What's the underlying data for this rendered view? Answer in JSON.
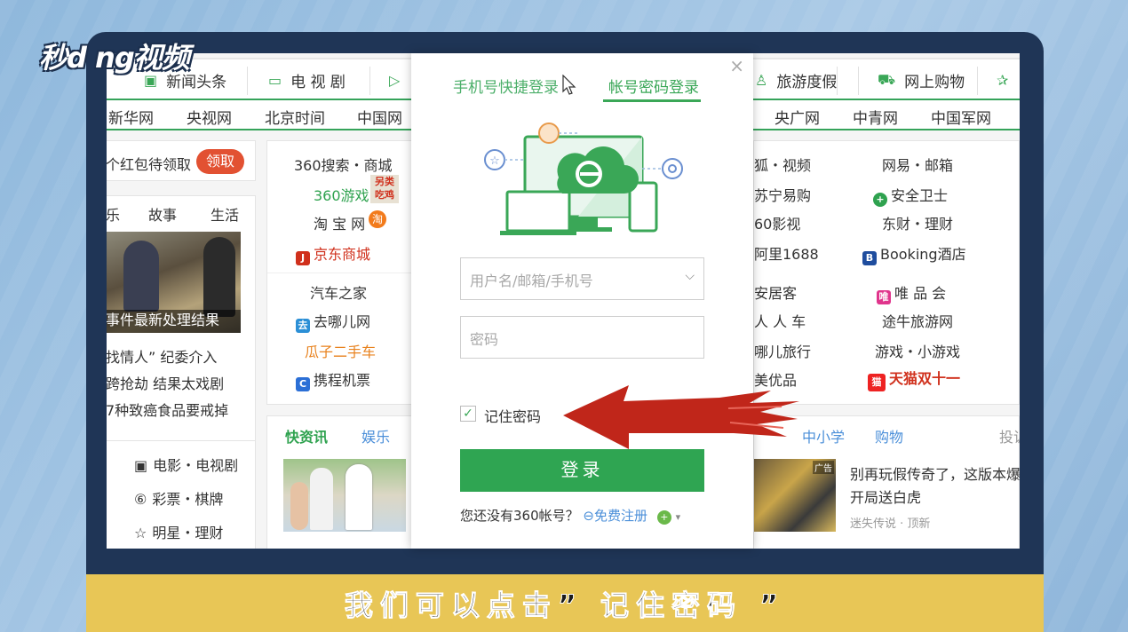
{
  "logo": "秒d ng视频",
  "caption": "我们可以点击” 记住密码 ”",
  "tabs": [
    {
      "icon": "news-icon",
      "glyph": "▣",
      "label": "新闻头条"
    },
    {
      "icon": "tv-icon",
      "glyph": "📺",
      "label": "电 视 剧"
    },
    {
      "icon": "video-icon",
      "glyph": "▷",
      "label": ""
    },
    {
      "icon": "travel-icon",
      "glyph": "♙",
      "label": "旅游度假"
    },
    {
      "icon": "cart-icon",
      "glyph": "🛒",
      "label": "网上购物"
    },
    {
      "icon": "star-icon",
      "glyph": "✰",
      "label": ""
    }
  ],
  "nav": [
    "新华网",
    "央视网",
    "北京时间",
    "中国网",
    "央广网",
    "中青网",
    "中国军网"
  ],
  "left": {
    "red_packet": "个红包待领取",
    "claim": "领取",
    "tabs": [
      "乐",
      "故事",
      "生活"
    ],
    "photo_caption": "事件最新处理结果",
    "news": [
      "找情人” 纪委介入",
      "跨抢劫 结果太戏剧",
      "7种致癌食品要戒掉"
    ],
    "bottom": [
      "电影・电视剧",
      "彩票・棋牌",
      "明星・理财"
    ]
  },
  "mid": {
    "links": [
      "360搜索・商城",
      "360游戏",
      "淘 宝 网",
      "京东商城",
      "汽车之家",
      "去哪儿网",
      "瓜子二手车",
      "携程机票"
    ],
    "game_badge": "另类吃鸡",
    "news_tabs": [
      "快资讯",
      "娱乐"
    ]
  },
  "right": {
    "col1": [
      "狐・视频",
      "苏宁易购",
      "60影视",
      "阿里1688",
      "安居客",
      "人 人 车",
      "哪儿旅行",
      "美优品"
    ],
    "col2": [
      "网易・邮箱",
      "安全卫士",
      "东财・理财",
      "Booking酒店",
      "唯 品 会",
      "途牛旅游网",
      "游戏・小游戏",
      "天猫双十一"
    ],
    "tabs": [
      "中小学",
      "购物",
      "投诉"
    ],
    "ad_tag": "广告",
    "ad_title": "别再玩假传奇了，这版本爆率",
    "ad_title2": "开局送白虎",
    "ad_source": "迷失传说 · 顶新"
  },
  "dialog": {
    "tab_phone": "手机号快捷登录",
    "tab_account": "帐号密码登录",
    "close": "×",
    "username_placeholder": "用户名/邮箱/手机号",
    "password_placeholder": "密码",
    "remember": "记住密码",
    "login": "登录",
    "no_account": "您还没有360帐号？",
    "register": "免费注册"
  },
  "colors": {
    "accent": "#3aa757",
    "arrow": "#c0261a",
    "caption_bg": "#e8c656",
    "frame": "#1f3556"
  }
}
